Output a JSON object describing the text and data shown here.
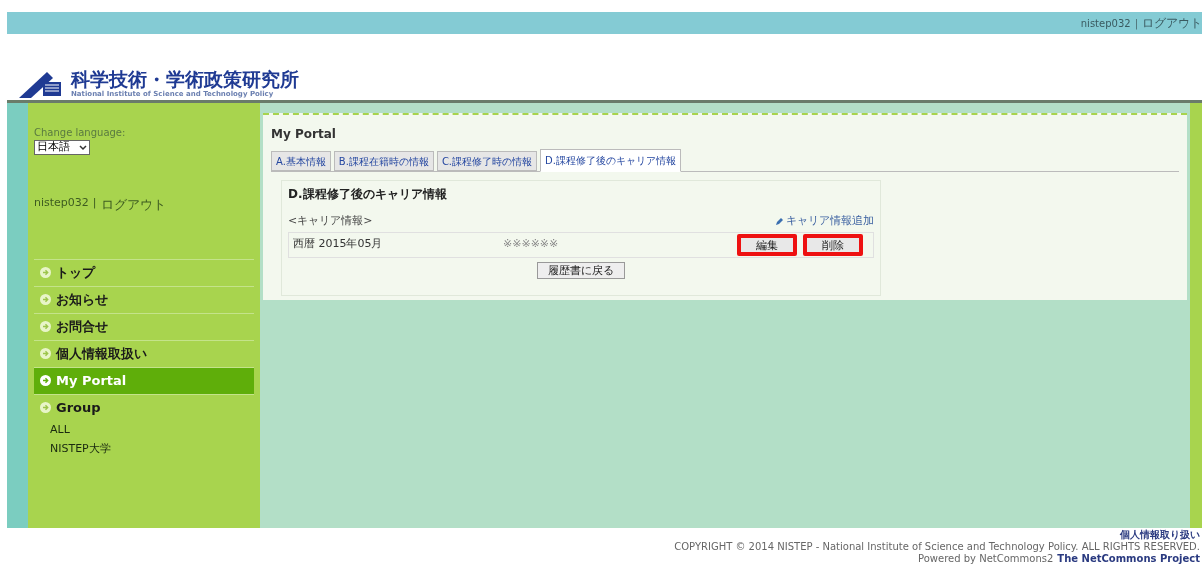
{
  "top_bar": {
    "user": "nistep032",
    "separator": "|",
    "logout": "ログアウト"
  },
  "header": {
    "title": "科学技術・学術政策研究所",
    "subtitle": "National Institute of Science and Technology Policy"
  },
  "sidebar": {
    "language_label": "Change language:",
    "language": "日本語",
    "user": "nistep032",
    "separator": "|",
    "logout": "ログアウト",
    "items": [
      {
        "label": "トップ",
        "selected": false
      },
      {
        "label": "お知らせ",
        "selected": false
      },
      {
        "label": "お問合せ",
        "selected": false
      },
      {
        "label": "個人情報取扱い",
        "selected": false
      },
      {
        "label": "My Portal",
        "selected": true
      },
      {
        "label": "Group",
        "selected": false,
        "children": [
          {
            "label": "ALL"
          },
          {
            "label": "NISTEP大学"
          }
        ]
      }
    ]
  },
  "portal": {
    "title": "My Portal",
    "tabs": [
      {
        "label": "A.基本情報",
        "selected": false
      },
      {
        "label": "B.課程在籍時の情報",
        "selected": false
      },
      {
        "label": "C.課程修了時の情報",
        "selected": false
      },
      {
        "label": "D.課程修了後のキャリア情報",
        "selected": true
      }
    ],
    "section_title": "D.課程修了後のキャリア情報",
    "list_label": "<キャリア情報>",
    "add_link": "キャリア情報追加",
    "rows": [
      {
        "date": "西暦 2015年05月",
        "value": "※※※※※※",
        "buttons": [
          {
            "label": "編集",
            "highlighted": true
          },
          {
            "label": "削除",
            "highlighted": true
          }
        ]
      }
    ],
    "back_button": "履歴書に戻る"
  },
  "footer": {
    "privacy": "個人情報取り扱い",
    "copyright": "COPYRIGHT © 2014 NISTEP - National Institute of Science and Technology Policy. ALL RIGHTS RESERVED.",
    "powered": "Powered by NetCommons2",
    "project": "The NetCommons Project"
  }
}
